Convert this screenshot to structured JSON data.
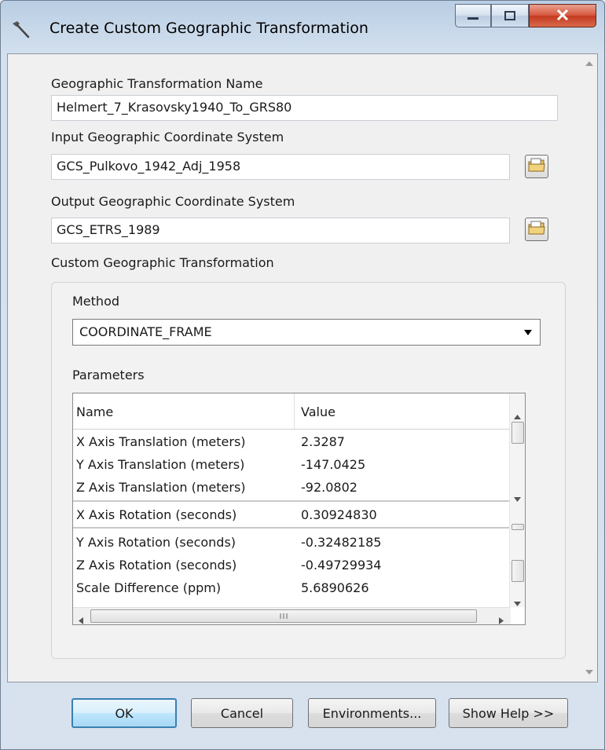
{
  "window": {
    "title": "Create Custom Geographic Transformation",
    "title_icon": "hammer-icon"
  },
  "fields": {
    "transformation_name": {
      "label": "Geographic Transformation Name",
      "value": "Helmert_7_Krasovsky1940_To_GRS80"
    },
    "input_gcs": {
      "label": "Input Geographic Coordinate System",
      "value": "GCS_Pulkovo_1942_Adj_1958"
    },
    "output_gcs": {
      "label": "Output Geographic Coordinate System",
      "value": "GCS_ETRS_1989"
    }
  },
  "custom": {
    "label": "Custom Geographic Transformation",
    "method_label": "Method",
    "method_value": "COORDINATE_FRAME",
    "parameters_label": "Parameters",
    "columns": [
      "Name",
      "Value"
    ],
    "rows": [
      {
        "name": "X Axis Translation (meters)",
        "value": "2.3287"
      },
      {
        "name": "Y Axis Translation (meters)",
        "value": "-147.0425"
      },
      {
        "name": "Z Axis Translation (meters)",
        "value": "-92.0802"
      },
      {
        "name": "X Axis Rotation (seconds)",
        "value": "0.30924830"
      },
      {
        "name": "Y Axis Rotation (seconds)",
        "value": "-0.32482185"
      },
      {
        "name": "Z Axis Rotation (seconds)",
        "value": "-0.49729934"
      },
      {
        "name": "Scale Difference (ppm)",
        "value": "5.6890626"
      }
    ]
  },
  "buttons": {
    "ok": "OK",
    "cancel": "Cancel",
    "environments": "Environments...",
    "show_help": "Show Help >>"
  },
  "colors": {
    "default_button_border": "#3c7fb1",
    "close_button": "#c33a1f"
  }
}
